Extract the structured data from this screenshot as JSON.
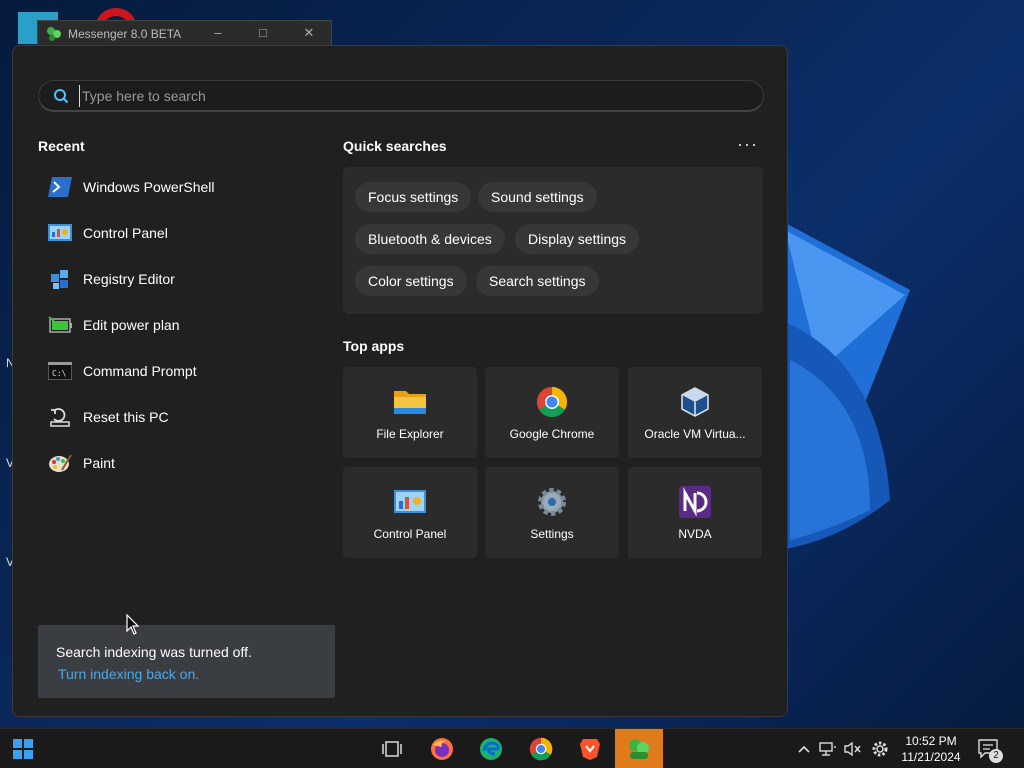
{
  "background_window": {
    "title": "Messenger 8.0 BETA"
  },
  "desktop": {
    "letters": [
      "N",
      "V",
      "V"
    ]
  },
  "search": {
    "placeholder": "Type here to search"
  },
  "recent": {
    "title": "Recent",
    "items": [
      {
        "label": "Windows PowerShell",
        "icon": "powershell-icon"
      },
      {
        "label": "Control Panel",
        "icon": "control-panel-icon"
      },
      {
        "label": "Registry Editor",
        "icon": "registry-editor-icon"
      },
      {
        "label": "Edit power plan",
        "icon": "battery-icon"
      },
      {
        "label": "Command Prompt",
        "icon": "command-prompt-icon"
      },
      {
        "label": "Reset this PC",
        "icon": "reset-pc-icon"
      },
      {
        "label": "Paint",
        "icon": "paint-icon"
      }
    ]
  },
  "quick_searches": {
    "title": "Quick searches",
    "more_label": "···",
    "chips": [
      "Focus settings",
      "Sound settings",
      "Bluetooth & devices",
      "Display settings",
      "Color settings",
      "Search settings"
    ]
  },
  "top_apps": {
    "title": "Top apps",
    "apps": [
      {
        "label": "File Explorer",
        "icon": "file-explorer-icon"
      },
      {
        "label": "Google Chrome",
        "icon": "chrome-icon"
      },
      {
        "label": "Oracle VM Virtua...",
        "icon": "virtualbox-icon"
      },
      {
        "label": "Control Panel",
        "icon": "control-panel-icon"
      },
      {
        "label": "Settings",
        "icon": "settings-gear-icon"
      },
      {
        "label": "NVDA",
        "icon": "nvda-icon"
      }
    ]
  },
  "notice": {
    "text": "Search indexing was turned off.",
    "link": "Turn indexing back on."
  },
  "taskbar": {
    "time": "10:52 PM",
    "date": "11/21/2024",
    "notification_count": "2",
    "accent_color": "#e07b1b"
  }
}
